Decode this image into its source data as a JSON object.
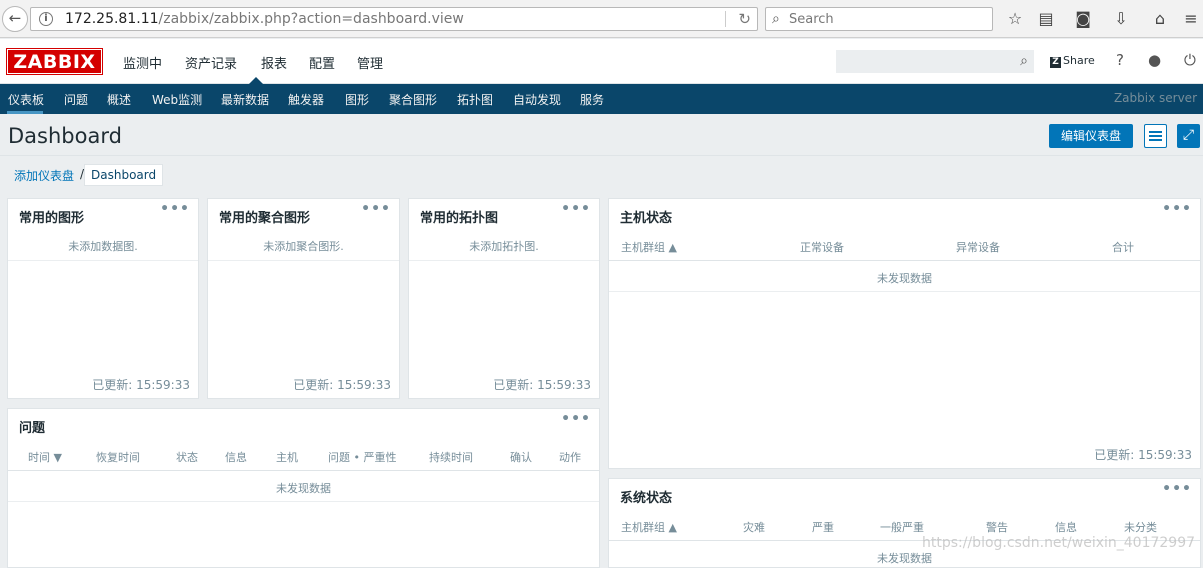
{
  "browser": {
    "url_host": "172.25.81.11",
    "url_path": "/zabbix/zabbix.php?action=dashboard.view",
    "search_placeholder": "Search"
  },
  "header": {
    "logo": "ZABBIX",
    "menu": [
      "监测中",
      "资产记录",
      "报表",
      "配置",
      "管理"
    ],
    "share_label": "Share",
    "help_label": "?"
  },
  "submenu": {
    "items": [
      "仪表板",
      "问题",
      "概述",
      "Web监测",
      "最新数据",
      "触发器",
      "图形",
      "聚合图形",
      "拓扑图",
      "自动发现",
      "服务"
    ],
    "server_label": "Zabbix server"
  },
  "page": {
    "title": "Dashboard",
    "edit_button": "编辑仪表盘"
  },
  "breadcrumb": {
    "link": "添加仪表盘",
    "separator": "/",
    "current": "Dashboard"
  },
  "widgets": {
    "fav_graphs": {
      "title": "常用的图形",
      "message": "未添加数据图.",
      "updated": "已更新: 15:59:33"
    },
    "fav_screens": {
      "title": "常用的聚合图形",
      "message": "未添加聚合图形.",
      "updated": "已更新: 15:59:33"
    },
    "fav_maps": {
      "title": "常用的拓扑图",
      "message": "未添加拓扑图.",
      "updated": "已更新: 15:59:33"
    },
    "host_status": {
      "title": "主机状态",
      "columns": [
        "主机群组 ▲",
        "正常设备",
        "异常设备",
        "合计"
      ],
      "message": "未发现数据",
      "updated": "已更新: 15:59:33"
    },
    "problems": {
      "title": "问题",
      "columns": [
        "时间 ▼",
        "恢复时间",
        "状态",
        "信息",
        "主机",
        "问题 • 严重性",
        "持续时间",
        "确认",
        "动作"
      ],
      "message": "未发现数据"
    },
    "system_status": {
      "title": "系统状态",
      "columns": [
        "主机群组 ▲",
        "灾难",
        "严重",
        "一般严重",
        "警告",
        "信息",
        "未分类"
      ],
      "message": "未发现数据"
    }
  },
  "watermark": "https://blog.csdn.net/weixin_40172997"
}
